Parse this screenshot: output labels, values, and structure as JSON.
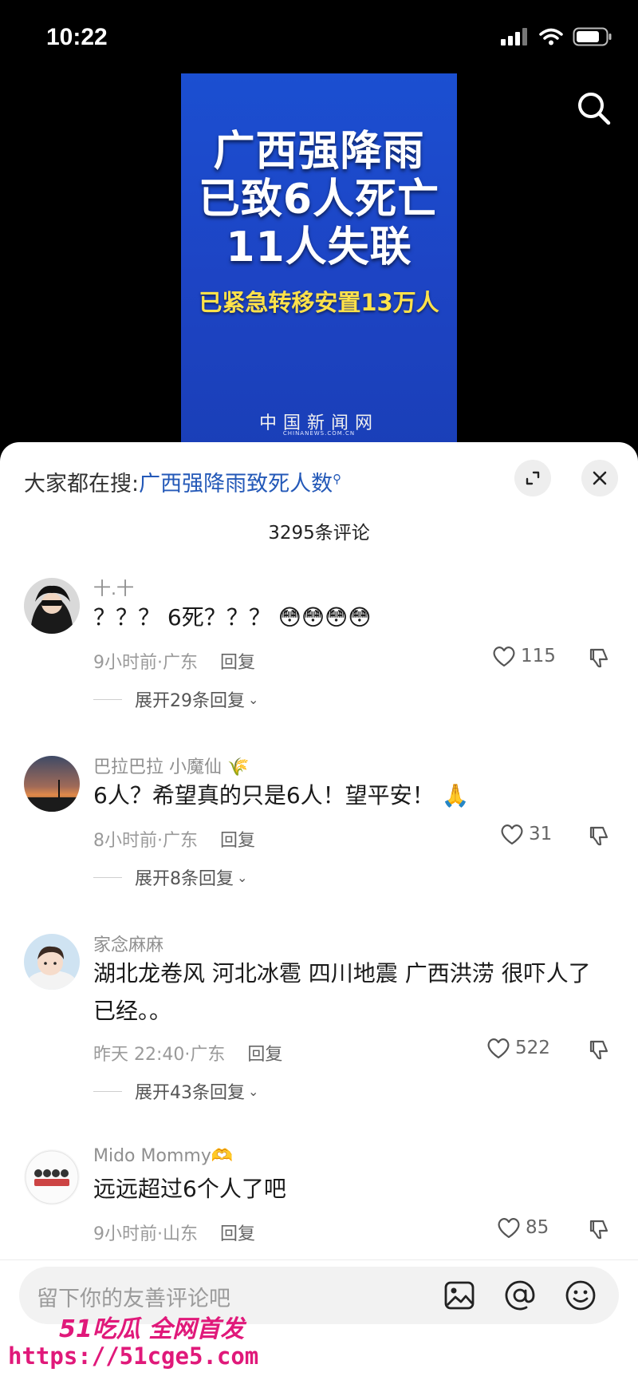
{
  "status_bar": {
    "time": "10:22"
  },
  "video": {
    "poster_lines": [
      "广西强降雨",
      "已致6人死亡",
      "11人失联"
    ],
    "poster_subline": "已紧急转移安置13万人",
    "poster_brand": "中国新闻网",
    "poster_brand_sub": "CHINANEWS.COM.CN"
  },
  "sheet": {
    "suggest_prefix": "大家都在搜:",
    "suggest_query": "广西强降雨致死人数",
    "comment_count": "3295条评论"
  },
  "comments": [
    {
      "name": "十.十",
      "text": "？？？ 6死？？？",
      "emoji": "😳😳😳😳",
      "time": "9小时前·广东",
      "reply": "回复",
      "likes": "115",
      "expand": "展开29条回复"
    },
    {
      "name": "巴拉巴拉 小魔仙",
      "name_emoji": "🌾",
      "text": "6人？希望真的只是6人！望平安！",
      "emoji": "🙏",
      "time": "8小时前·广东",
      "reply": "回复",
      "likes": "31",
      "expand": "展开8条回复"
    },
    {
      "name": "家念麻麻",
      "text": "湖北龙卷风 河北冰雹 四川地震 广西洪涝 很吓人了已经。。",
      "time": "昨天 22:40·广东",
      "reply": "回复",
      "likes": "522",
      "expand": "展开43条回复"
    },
    {
      "name": "Mido Mommy",
      "name_emoji": "🫶",
      "text": "远远超过6个人了吧",
      "time": "9小时前·山东",
      "reply": "回复",
      "likes": "85"
    }
  ],
  "input": {
    "placeholder": "留下你的友善评论吧"
  },
  "watermark": {
    "line1": "51吃瓜 全网首发",
    "url": "https://51cge5.com"
  },
  "colors": {
    "poster_blue": "#1b4fd1",
    "link_blue": "#2459b8",
    "subline_yellow": "#ffe24a",
    "watermark_pink": "#e0197a"
  }
}
